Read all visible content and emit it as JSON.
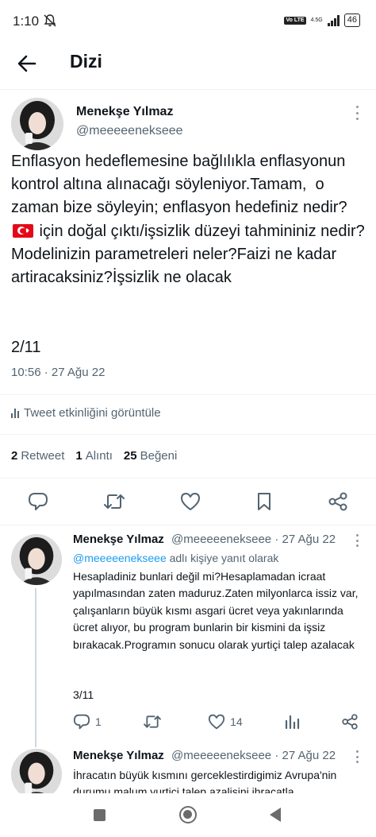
{
  "status_bar": {
    "time": "1:10",
    "volte": "Vo LTE",
    "network": "4.5G",
    "battery": "46"
  },
  "header": {
    "title": "Dizi"
  },
  "main_tweet": {
    "author_name": "Menekşe Yılmaz",
    "handle": "@meeeeenekseee",
    "text_before_flag": "Enflasyon hedeflemesine bağlılıkla enflasyonun kontrol altına alınacağı söyleniyor.Tamam,  o zaman bize söyleyin; enflasyon hedefiniz nedir? ",
    "text_after_flag": " için doğal çıktı/işsizlik düzeyi tahmininiz nedir? Modelinizin parametreleri neler?Faizi ne kadar artiracaksiniz?İşsizlik ne olacak",
    "thread_count": "2/11",
    "timestamp": "10:56 · 27 Ağu 22",
    "analytics_label": "Tweet etkinliğini görüntüle",
    "stats": {
      "retweets_count": "2",
      "retweets_label": "Retweet",
      "quotes_count": "1",
      "quotes_label": "Alıntı",
      "likes_count": "25",
      "likes_label": "Beğeni"
    }
  },
  "replies": [
    {
      "author_name": "Menekşe Yılmaz",
      "handle_date": "@meeeeenekseee · 27 Ağu 22",
      "reply_to_handle": "@meeeeenekseee",
      "reply_to_suffix": " adlı kişiye yanıt olarak",
      "text": "Hesapladiniz bunlari değil mi?Hesaplamadan icraat yapılmasından zaten maduruz.Zaten milyonlarca issiz var, çalışanların büyük kısmı asgari ücret veya yakınlarında ücret alıyor, bu program bunlarin bir kismini da işsiz bırakacak.Programın sonucu olarak yurtiçi talep azalacak",
      "thread_count": "3/11",
      "reply_count": "1",
      "retweet_count": "",
      "like_count": "14"
    },
    {
      "author_name": "Menekşe Yılmaz",
      "handle_date": "@meeeeenekseee · 27 Ağu 22",
      "text": "İhracatın büyük kısmını gerceklestirdigimiz Avrupa'nin durumu malum,yurtiçi talep azalişini ihracatla"
    }
  ],
  "icons": {
    "back": "arrow-left-icon",
    "reply": "speech-bubble-icon",
    "retweet": "retweet-arrows-icon",
    "like": "heart-icon",
    "bookmark": "bookmark-icon",
    "share": "share-nodes-icon",
    "analytics": "bar-chart-icon",
    "more": "more-vertical-icon"
  },
  "colors": {
    "text_primary": "#0f1419",
    "text_secondary": "#536471",
    "link": "#1d9bf0",
    "flag_red": "#e30a17"
  }
}
